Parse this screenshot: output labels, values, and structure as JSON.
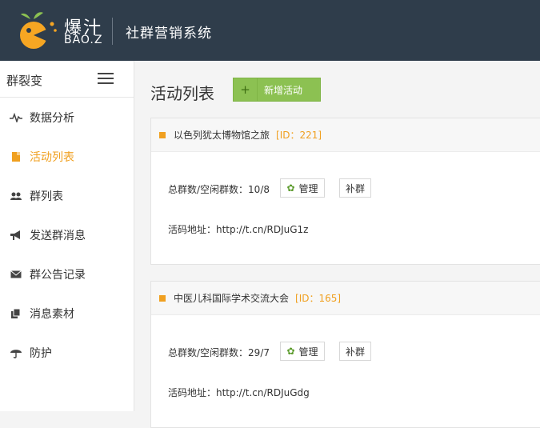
{
  "brand": {
    "name_cn": "爆汁",
    "name_en": "BAO.Z",
    "system_title": "社群营销系统",
    "colors": {
      "header_bg": "#2f3d4b",
      "accent": "#f0a020",
      "green": "#8cc152"
    }
  },
  "sidebar": {
    "title": "群裂变",
    "items": [
      {
        "label": "数据分析",
        "icon": "pulse-icon",
        "active": false
      },
      {
        "label": "活动列表",
        "icon": "document-icon",
        "active": true
      },
      {
        "label": "群列表",
        "icon": "group-icon",
        "active": false
      },
      {
        "label": "发送群消息",
        "icon": "megaphone-icon",
        "active": false
      },
      {
        "label": "群公告记录",
        "icon": "envelope-icon",
        "active": false
      },
      {
        "label": "消息素材",
        "icon": "copy-icon",
        "active": false
      },
      {
        "label": "防护",
        "icon": "umbrella-icon",
        "active": false
      }
    ]
  },
  "main": {
    "title": "活动列表",
    "new_button": {
      "icon": "+",
      "label": "新增活动"
    },
    "cards": [
      {
        "name": "以色列犹太博物馆之旅",
        "id_label": "[ID：221]",
        "stat_text": "总群数/空闲群数：10/8",
        "manage_label": "管理",
        "fill_label": "补群",
        "link_text": "活码地址：http://t.cn/RDJuG1z"
      },
      {
        "name": "中医儿科国际学术交流大会",
        "id_label": "[ID：165]",
        "stat_text": "总群数/空闲群数：29/7",
        "manage_label": "管理",
        "fill_label": "补群",
        "link_text": "活码地址：http://t.cn/RDJuGdg"
      }
    ]
  }
}
